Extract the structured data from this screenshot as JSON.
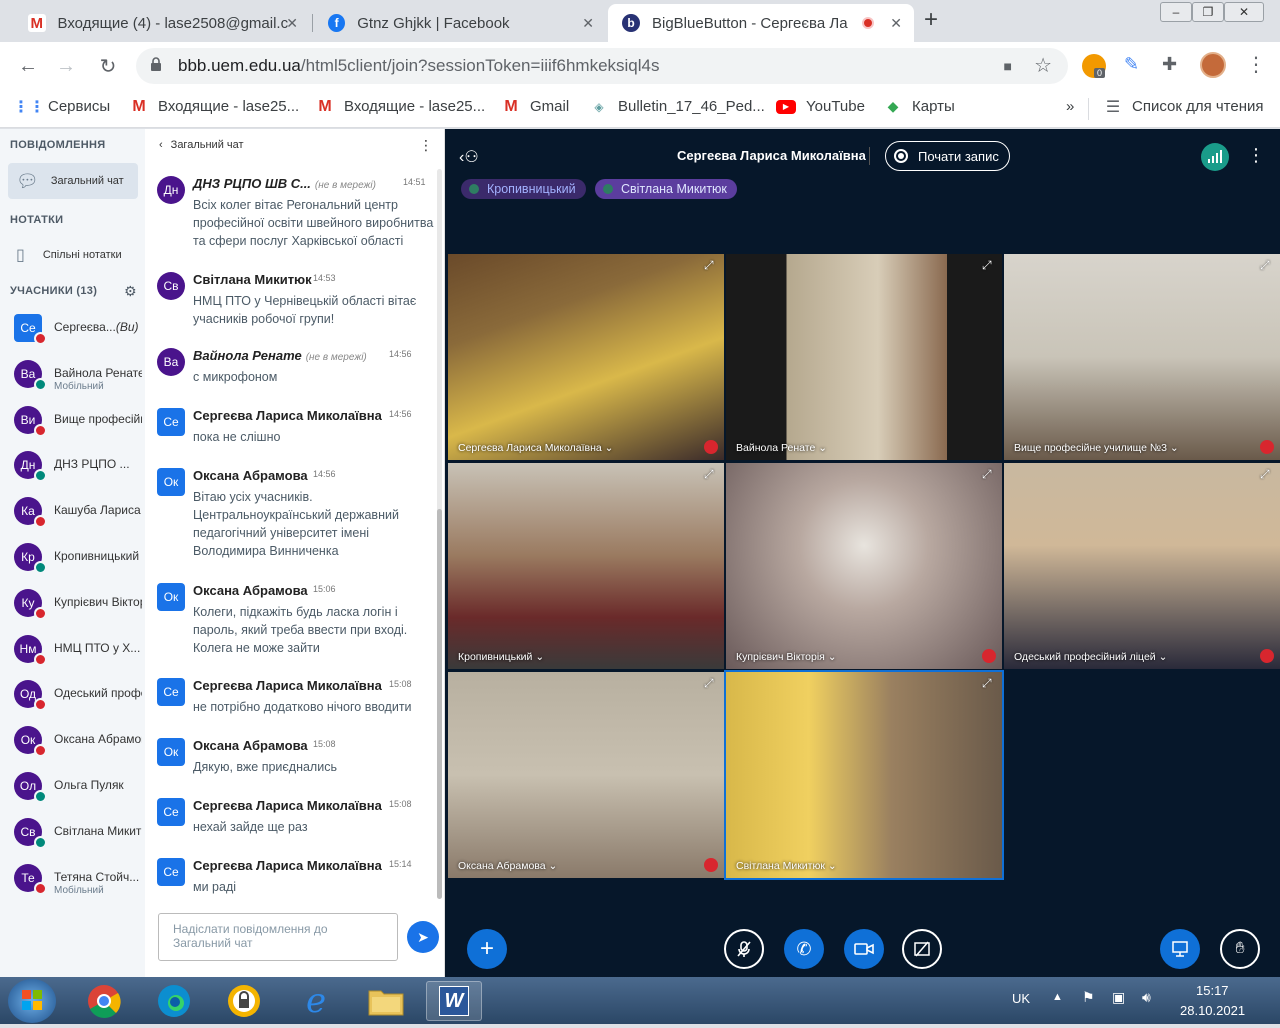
{
  "browser": {
    "tabs": [
      {
        "label": "Входящие (4) - lase2508@gmail.c",
        "icon": "gmail-icon"
      },
      {
        "label": "Gtnz Ghjkk | Facebook",
        "icon": "facebook-icon"
      },
      {
        "label": "BigBlueButton - Сергеєва Ла",
        "icon": "bigbluebutton-icon"
      }
    ],
    "url_host": "bbb.uem.edu.ua",
    "url_path": "/html5client/join?sessionToken=iiif6hmkeksiql4s",
    "extension_badge": "0",
    "bookmarks": [
      {
        "label": "Сервисы",
        "icon": "apps-icon"
      },
      {
        "label": "Входящие - lase25...",
        "icon": "gmail-icon"
      },
      {
        "label": "Входящие - lase25...",
        "icon": "gmail-icon"
      },
      {
        "label": "Gmail",
        "icon": "gmail-icon"
      },
      {
        "label": "Bulletin_17_46_Ped...",
        "icon": "page-icon"
      },
      {
        "label": "YouTube",
        "icon": "youtube-icon"
      },
      {
        "label": "Карты",
        "icon": "maps-icon"
      }
    ],
    "reading_list": "Список для чтения",
    "more_bookmarks": "»"
  },
  "sidebar": {
    "messages_section": "ПОВІДОМЛЕННЯ",
    "public_chat": "Загальний чат",
    "notes_section": "НОТАТКИ",
    "shared_notes": "Спільні нотатки",
    "users_section": "УЧАСНИКИ (13)",
    "users": [
      {
        "initials": "Се",
        "name": "Сергеєва...",
        "suffix": "(Ви)",
        "sub": "",
        "badge": "red",
        "me": true
      },
      {
        "initials": "Ва",
        "name": "Вайнола Ренате",
        "sub": "Мобільний",
        "badge": "green"
      },
      {
        "initials": "Ви",
        "name": "Вище професійне",
        "sub": "",
        "badge": "red"
      },
      {
        "initials": "Дн",
        "name": "ДНЗ РЦПО ...",
        "sub": "",
        "badge": "green"
      },
      {
        "initials": "Ка",
        "name": "Кашуба Лариса",
        "sub": "",
        "badge": "red"
      },
      {
        "initials": "Кр",
        "name": "Кропивницький",
        "sub": "",
        "badge": "green"
      },
      {
        "initials": "Ку",
        "name": "Купрієвич Вікторія",
        "sub": "",
        "badge": "red"
      },
      {
        "initials": "Нм",
        "name": "НМЦ ПТО у Х...",
        "sub": "",
        "badge": "red"
      },
      {
        "initials": "Од",
        "name": "Одеський професійний",
        "sub": "",
        "badge": "red"
      },
      {
        "initials": "Ок",
        "name": "Оксана Абрамова",
        "sub": "",
        "badge": "red"
      },
      {
        "initials": "Ол",
        "name": "Ольга Пуляк",
        "sub": "",
        "badge": "green"
      },
      {
        "initials": "Св",
        "name": "Світлана Микитюк",
        "sub": "",
        "badge": "green"
      },
      {
        "initials": "Те",
        "name": "Тетяна Стойч...",
        "sub": "Мобільний",
        "badge": "red"
      }
    ]
  },
  "chat": {
    "header": "Загальний чат",
    "input_placeholder": "Надіслати повідомлення до Загальний чат",
    "messages": [
      {
        "initials": "Дн",
        "name": "ДНЗ РЦПО ШВ С...",
        "status": "(не в мережі)",
        "time": "14:51",
        "text": "Всіх колег вітає Регональний центр професійної освіти швейного виробнитва та сфери послуг Харківської області",
        "italic": true
      },
      {
        "initials": "Св",
        "name": "Світлана Микитюк",
        "status": "",
        "time": "14:53",
        "text": "НМЦ ПТО у Чернівецькій області вітає учасників робочої групи!"
      },
      {
        "initials": "Ва",
        "name": "Вайнола Ренате",
        "status": "(не в мережі)",
        "time": "14:56",
        "text": "с микрофоном",
        "italic": true
      },
      {
        "initials": "Се",
        "name": "Сергеєва Лариса Миколаївна",
        "status": "",
        "time": "14:56",
        "text": "пока не слішно",
        "blue": true
      },
      {
        "initials": "Ок",
        "name": "Оксана Абрамова",
        "status": "",
        "time": "14:56",
        "text": "Вітаю усіх учасників. Центральноукраїнський державний педагогічний університет імені Володимира Винниченка",
        "blue": true
      },
      {
        "initials": "Ок",
        "name": "Оксана Абрамова",
        "status": "",
        "time": "15:06",
        "text": "Колеги, підкажіть будь ласка логін і пароль, який треба ввести при вході. Колега не може зайти",
        "blue": true
      },
      {
        "initials": "Се",
        "name": "Сергеєва Лариса Миколаївна",
        "status": "",
        "time": "15:08",
        "text": "не потрібно додатково нічого вводити",
        "blue": true
      },
      {
        "initials": "Ок",
        "name": "Оксана Абрамова",
        "status": "",
        "time": "15:08",
        "text": "Дякую, вже приєднались",
        "blue": true
      },
      {
        "initials": "Се",
        "name": "Сергеєва Лариса Миколаївна",
        "status": "",
        "time": "15:08",
        "text": "нехай зайде ще раз",
        "blue": true
      },
      {
        "initials": "Се",
        "name": "Сергеєва Лариса Миколаївна",
        "status": "",
        "time": "15:14",
        "text": "ми раді",
        "blue": true
      }
    ]
  },
  "main": {
    "title": "Сергеєва Лариса Миколаївна",
    "record_label": "Почати запис",
    "talking": [
      "Кропивницький",
      "Світлана Микитюк"
    ],
    "videos": [
      {
        "label": "Сергеєва Лариса Миколаївна ⌄",
        "muted": true
      },
      {
        "label": "Вайнола Ренате ⌄",
        "muted": false
      },
      {
        "label": "Вище професійне училище №3 ⌄",
        "muted": true
      },
      {
        "label": "Кропивницький ⌄",
        "muted": false
      },
      {
        "label": "Купрієвич Вікторія ⌄",
        "muted": true
      },
      {
        "label": "Одеський професійний ліцей ⌄",
        "muted": true
      },
      {
        "label": "Оксана Абрамова ⌄",
        "muted": true
      },
      {
        "label": "Світлана Микитюк ⌄",
        "muted": false
      }
    ],
    "accent": "#0f70d7"
  },
  "taskbar": {
    "lang": "UK",
    "time": "15:17",
    "date": "28.10.2021"
  }
}
